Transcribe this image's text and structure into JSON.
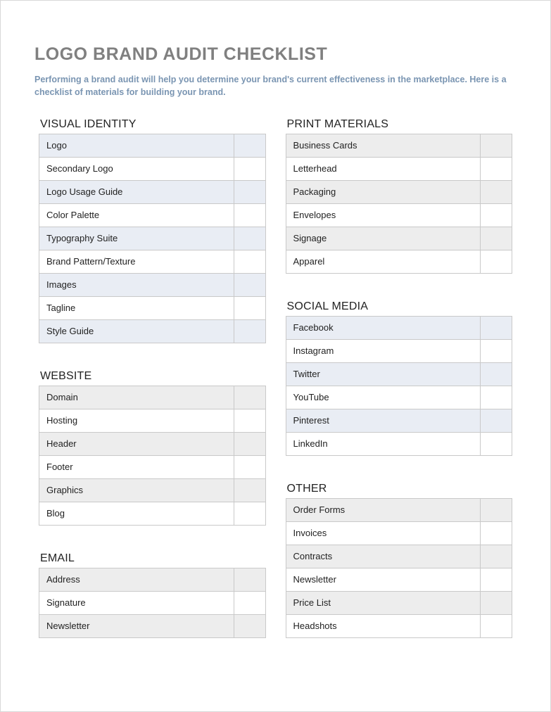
{
  "title": "LOGO BRAND AUDIT CHECKLIST",
  "subtitle": "Performing a brand audit will help you determine your brand's current effectiveness in the marketplace. Here is a checklist of materials for building your brand.",
  "left": [
    {
      "heading": "VISUAL IDENTITY",
      "shade": "blue",
      "items": [
        "Logo",
        "Secondary Logo",
        "Logo Usage Guide",
        "Color Palette",
        "Typography Suite",
        "Brand Pattern/Texture",
        "Images",
        "Tagline",
        "Style Guide"
      ]
    },
    {
      "heading": "WEBSITE",
      "shade": "gray",
      "items": [
        "Domain",
        "Hosting",
        "Header",
        "Footer",
        "Graphics",
        "Blog"
      ]
    },
    {
      "heading": "EMAIL",
      "shade": "gray",
      "items": [
        "Address",
        "Signature",
        "Newsletter"
      ]
    }
  ],
  "right": [
    {
      "heading": "PRINT MATERIALS",
      "shade": "gray",
      "items": [
        "Business Cards",
        "Letterhead",
        "Packaging",
        "Envelopes",
        "Signage",
        "Apparel"
      ]
    },
    {
      "heading": "SOCIAL MEDIA",
      "shade": "blue",
      "items": [
        "Facebook",
        "Instagram",
        "Twitter",
        "YouTube",
        "Pinterest",
        "LinkedIn"
      ]
    },
    {
      "heading": "OTHER",
      "shade": "gray",
      "items": [
        "Order Forms",
        "Invoices",
        "Contracts",
        "Newsletter",
        "Price List",
        "Headshots"
      ]
    }
  ]
}
